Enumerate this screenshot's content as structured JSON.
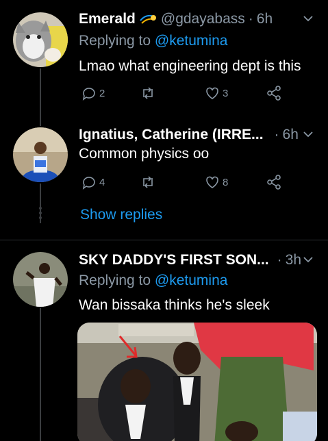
{
  "tweets": [
    {
      "name": "Emerald",
      "name_emoji": "☄",
      "handle": "@gdayabass",
      "time": "6h",
      "replying_prefix": "Replying to",
      "replying_to": "@ketumina",
      "text": "Lmao what engineering dept is this",
      "replies": "2",
      "retweets": "",
      "likes": "3"
    },
    {
      "name": "Ignatius, Catherine (IRRE...",
      "handle": "",
      "time": "6h",
      "text": "Common physics oo",
      "replies": "4",
      "retweets": "",
      "likes": "8",
      "show_replies": "Show replies"
    },
    {
      "name": "SKY DADDY'S FIRST SON...",
      "handle": "",
      "time": "3h",
      "replying_prefix": "Replying to",
      "replying_to": "@ketumina",
      "text": "Wan bissaka thinks he's sleek"
    }
  ],
  "colors": {
    "background": "#000000",
    "text": "#e7e9ea",
    "secondary": "#8b98a5",
    "link": "#1d9bf0",
    "divider": "#2f3336"
  },
  "icons": [
    "reply-icon",
    "retweet-icon",
    "like-icon",
    "share-icon",
    "chevron-down-icon",
    "comet-emoji-icon"
  ]
}
